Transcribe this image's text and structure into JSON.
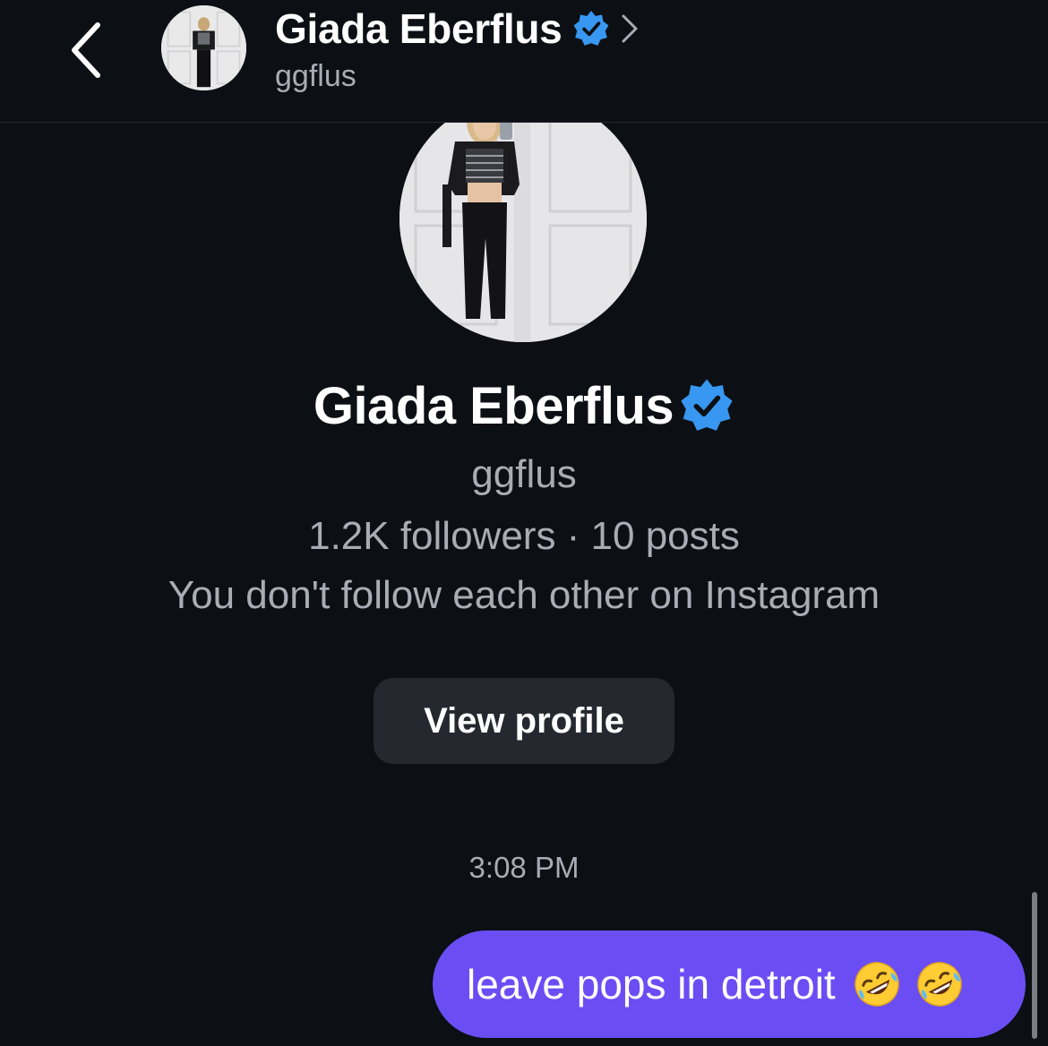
{
  "header": {
    "back_icon": "chevron-left-icon",
    "name": "Giada Eberflus",
    "verified_icon": "verified-badge-icon",
    "chevron_icon": "chevron-right-icon",
    "username": "ggflus"
  },
  "profile": {
    "name": "Giada Eberflus",
    "verified_icon": "verified-badge-icon",
    "username": "ggflus",
    "stats": "1.2K followers · 10 posts",
    "relationship": "You don't follow each other on Instagram",
    "view_profile_label": "View profile"
  },
  "conversation": {
    "timestamp": "3:08 PM",
    "messages": [
      {
        "from": "me",
        "text": "leave pops in detroit",
        "emojis": [
          "rofl-emoji-icon",
          "rofl-emoji-icon"
        ]
      }
    ]
  },
  "colors": {
    "background": "#0c0f14",
    "secondary_text": "#a8adb5",
    "verified_blue": "#3897f0",
    "bubble_purple": "#6a4ef4",
    "button_bg": "#25282e"
  }
}
